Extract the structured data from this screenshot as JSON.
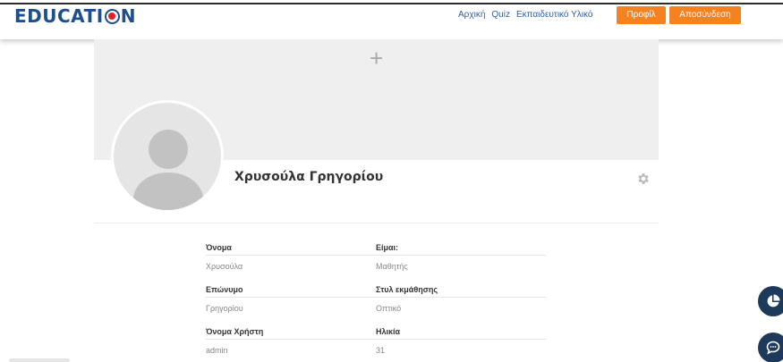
{
  "header": {
    "logo_prefix": "EDUCATI",
    "logo_suffix": "N",
    "nav": [
      "Αρχική",
      "Quiz",
      "Εκπαιδευτικό Υλικό"
    ],
    "profile_label": "Προφίλ",
    "logout_label": "Αποσύνδεση"
  },
  "profile": {
    "cover_plus": "+",
    "full_name": "Χρυσούλα Γρηγορίου"
  },
  "fields": {
    "first_name_label": "Όνομα",
    "first_name_value": "Χρυσούλα",
    "last_name_label": "Επώνυμο",
    "last_name_value": "Γρηγορίου",
    "username_label": "Όνομα Χρήστη",
    "username_value": "admin",
    "role_label": "Είμαι:",
    "role_value": "Μαθητής",
    "learning_style_label": "Στυλ εκμάθησης",
    "learning_style_value": "Οπτικό",
    "age_label": "Ηλικία",
    "age_value": "31"
  },
  "colors": {
    "brand_blue": "#1f4e8c",
    "accent_orange": "#f58220",
    "fab_navy": "#1d3a5b"
  },
  "icons": [
    "plus-icon",
    "gear-icon",
    "pie-chart-icon",
    "chat-icon"
  ]
}
